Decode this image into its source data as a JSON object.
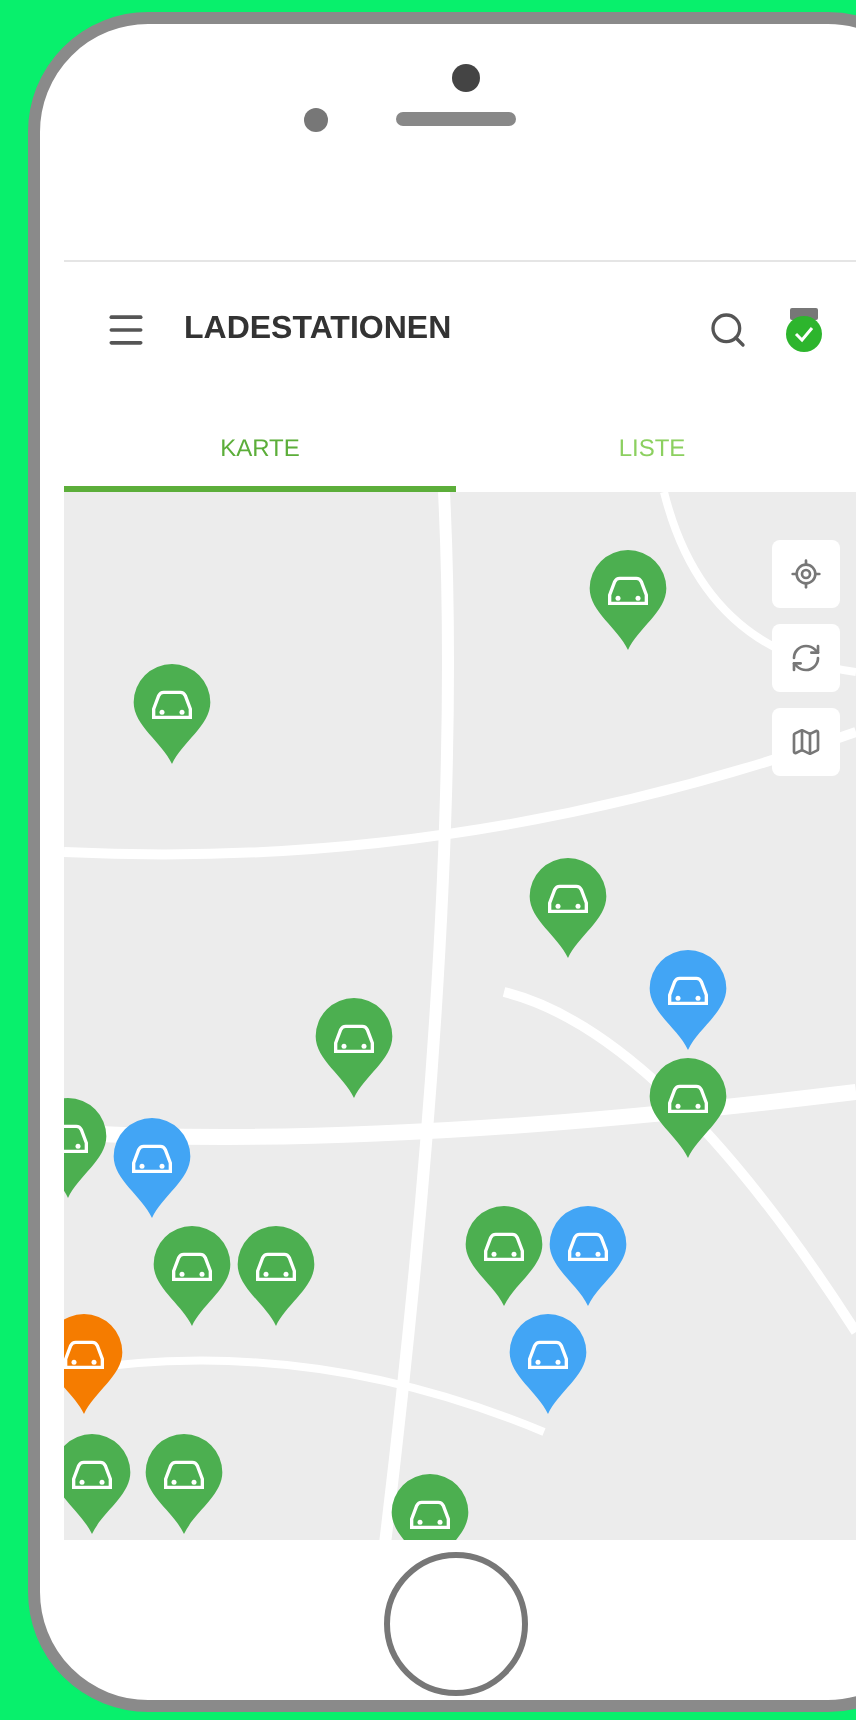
{
  "app_bar": {
    "title": "LADESTATIONEN"
  },
  "tabs": [
    {
      "label": "KARTE",
      "selected": true
    },
    {
      "label": "LISTE",
      "selected": false
    }
  ],
  "map": {
    "kind": "picture",
    "pins": [
      {
        "color": "#4caf50"
      },
      {
        "color": "#4caf50"
      },
      {
        "color": "#4caf50"
      },
      {
        "color": "#42a5f5"
      },
      {
        "color": "#4caf50"
      },
      {
        "color": "#4caf50"
      },
      {
        "color": "#4caf50"
      },
      {
        "color": "#42a5f5"
      },
      {
        "color": "#4caf50"
      },
      {
        "color": "#4caf50"
      },
      {
        "color": "#4caf50"
      },
      {
        "color": "#42a5f5"
      },
      {
        "color": "#42a5f5"
      },
      {
        "color": "#f57c00"
      },
      {
        "color": "#4caf50"
      },
      {
        "color": "#4caf50"
      },
      {
        "color": "#4caf50"
      }
    ]
  }
}
